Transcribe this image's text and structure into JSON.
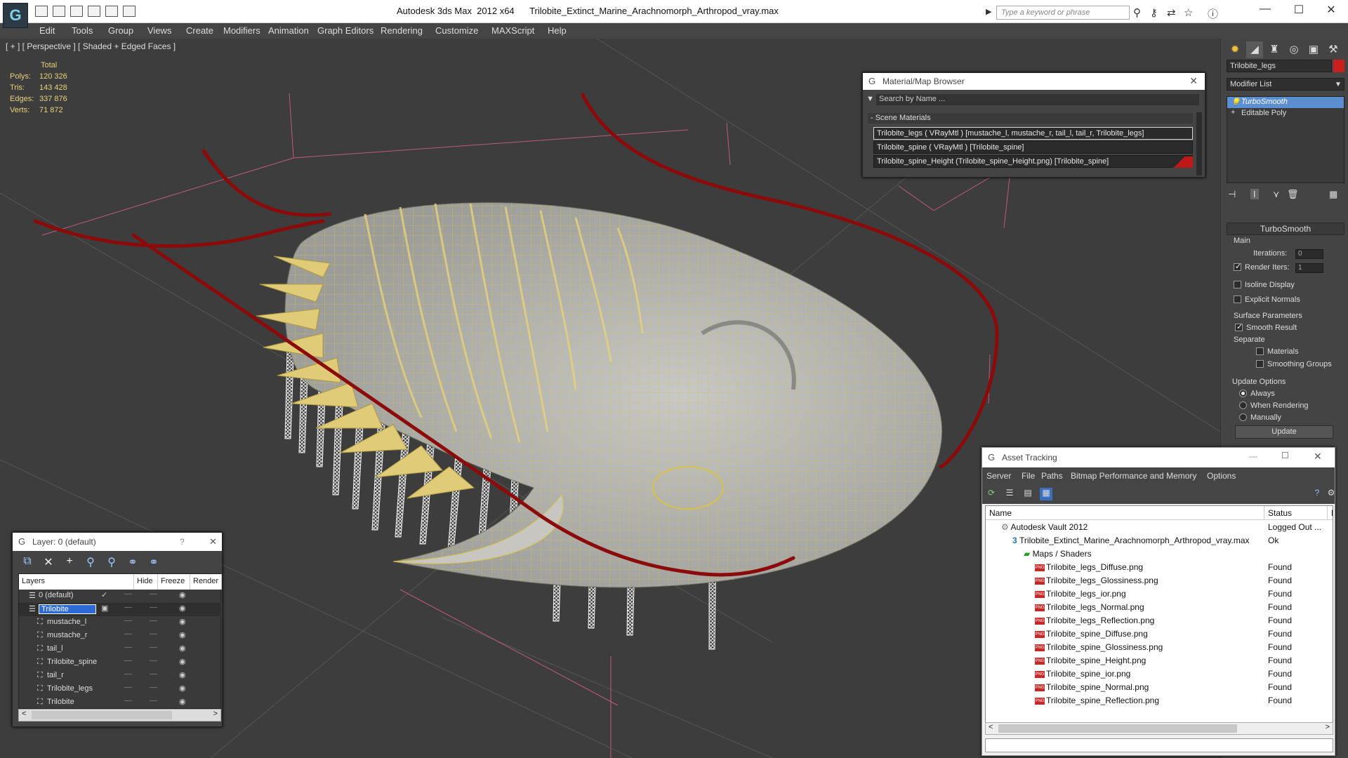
{
  "title_bar": {
    "app_title": "Autodesk 3ds Max  2012 x64      Trilobite_Extinct_Marine_Arachnomorph_Arthropod_vray.max",
    "search_placeholder": "Type a keyword or phrase",
    "minimize": "—",
    "maximize": "☐",
    "close": "✕"
  },
  "menu": [
    "Edit",
    "Tools",
    "Group",
    "Views",
    "Create",
    "Modifiers",
    "Animation",
    "Graph Editors",
    "Rendering",
    "Customize",
    "MAXScript",
    "Help"
  ],
  "viewport": {
    "label": "[ + ] [ Perspective ] [ Shaded + Edged Faces ]",
    "stats_header": "Total",
    "stats": [
      {
        "key": "Polys:",
        "value": "120 326"
      },
      {
        "key": "Tris:",
        "value": "143 428"
      },
      {
        "key": "Edges:",
        "value": "337 876"
      },
      {
        "key": "Verts:",
        "value": "71 872"
      }
    ]
  },
  "command_panel": {
    "object_name": "Trilobite_legs",
    "object_color": "#c91f1f",
    "modifier_list": "Modifier List",
    "stack": [
      "TurboSmooth",
      "Editable Poly"
    ],
    "rollout_title": "TurboSmooth",
    "main_label": "Main",
    "iterations_label": "Iterations:",
    "iterations_value": "0",
    "render_iters_label": "Render Iters:",
    "render_iters_value": "1",
    "isoline": "Isoline Display",
    "explicit_normals": "Explicit Normals",
    "surface_params": "Surface Parameters",
    "smooth_result": "Smooth Result",
    "separate": "Separate",
    "materials": "Materials",
    "smoothing_groups": "Smoothing Groups",
    "update_options": "Update Options",
    "always": "Always",
    "when_rendering": "When Rendering",
    "manually": "Manually",
    "update_button": "Update"
  },
  "material_browser": {
    "title": "Material/Map Browser",
    "search_placeholder": "Search by Name ...",
    "group": "- Scene Materials",
    "rows": [
      "Trilobite_legs  ( VRayMtl )  [mustache_l, mustache_r, tail_l, tail_r, Trilobite_legs]",
      "Trilobite_spine  ( VRayMtl )  [Trilobite_spine]",
      "Trilobite_spine_Height (Trilobite_spine_Height.png) [Trilobite_spine]"
    ]
  },
  "layer_panel": {
    "title": "Layer: 0 (default)",
    "help": "?",
    "close": "✕",
    "columns": [
      "Layers",
      "Hide",
      "Freeze",
      "Render"
    ],
    "rows": [
      {
        "name": "0 (default)",
        "level": 0
      },
      {
        "name": "Trilobite",
        "level": 0
      },
      {
        "name": "mustache_l",
        "level": 1
      },
      {
        "name": "mustache_r",
        "level": 1
      },
      {
        "name": "tail_l",
        "level": 1
      },
      {
        "name": "Trilobite_spine",
        "level": 1
      },
      {
        "name": "tail_r",
        "level": 1
      },
      {
        "name": "Trilobite_legs",
        "level": 1
      },
      {
        "name": "Trilobite",
        "level": 1
      }
    ]
  },
  "asset_tracking": {
    "title": "Asset Tracking",
    "menu": [
      "Server",
      "File",
      "Paths",
      "Bitmap Performance and Memory",
      "Options"
    ],
    "col_name": "Name",
    "col_status": "Status",
    "col_p": "P",
    "rows": [
      {
        "name": "Autodesk Vault 2012",
        "status": "Logged Out ...",
        "indent": 0,
        "icon": "vault"
      },
      {
        "name": "Trilobite_Extinct_Marine_Arachnomorph_Arthropod_vray.max",
        "status": "Ok",
        "indent": 1,
        "icon": "max"
      },
      {
        "name": "Maps / Shaders",
        "status": "",
        "indent": 2,
        "icon": "folder"
      },
      {
        "name": "Trilobite_legs_Diffuse.png",
        "status": "Found",
        "indent": 3,
        "icon": "png"
      },
      {
        "name": "Trilobite_legs_Glossiness.png",
        "status": "Found",
        "indent": 3,
        "icon": "png"
      },
      {
        "name": "Trilobite_legs_ior.png",
        "status": "Found",
        "indent": 3,
        "icon": "png"
      },
      {
        "name": "Trilobite_legs_Normal.png",
        "status": "Found",
        "indent": 3,
        "icon": "png"
      },
      {
        "name": "Trilobite_legs_Reflection.png",
        "status": "Found",
        "indent": 3,
        "icon": "png"
      },
      {
        "name": "Trilobite_spine_Diffuse.png",
        "status": "Found",
        "indent": 3,
        "icon": "png"
      },
      {
        "name": "Trilobite_spine_Glossiness.png",
        "status": "Found",
        "indent": 3,
        "icon": "png"
      },
      {
        "name": "Trilobite_spine_Height.png",
        "status": "Found",
        "indent": 3,
        "icon": "png"
      },
      {
        "name": "Trilobite_spine_ior.png",
        "status": "Found",
        "indent": 3,
        "icon": "png"
      },
      {
        "name": "Trilobite_spine_Normal.png",
        "status": "Found",
        "indent": 3,
        "icon": "png"
      },
      {
        "name": "Trilobite_spine_Reflection.png",
        "status": "Found",
        "indent": 3,
        "icon": "png"
      }
    ]
  }
}
